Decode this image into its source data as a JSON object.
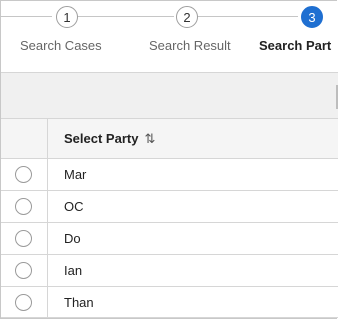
{
  "steps": [
    {
      "number": "1",
      "label": "Search Cases",
      "active": false
    },
    {
      "number": "2",
      "label": "Search Result",
      "active": false
    },
    {
      "number": "3",
      "label": "Search Part",
      "active": true
    }
  ],
  "table": {
    "header": {
      "label": "Select Party",
      "sort_icon": "sort-icon"
    },
    "rows": [
      {
        "name": "Mar"
      },
      {
        "name": "OC"
      },
      {
        "name": "Do"
      },
      {
        "name": "Ian"
      },
      {
        "name": "Than"
      }
    ]
  },
  "colors": {
    "accent": "#1f6fd1"
  }
}
